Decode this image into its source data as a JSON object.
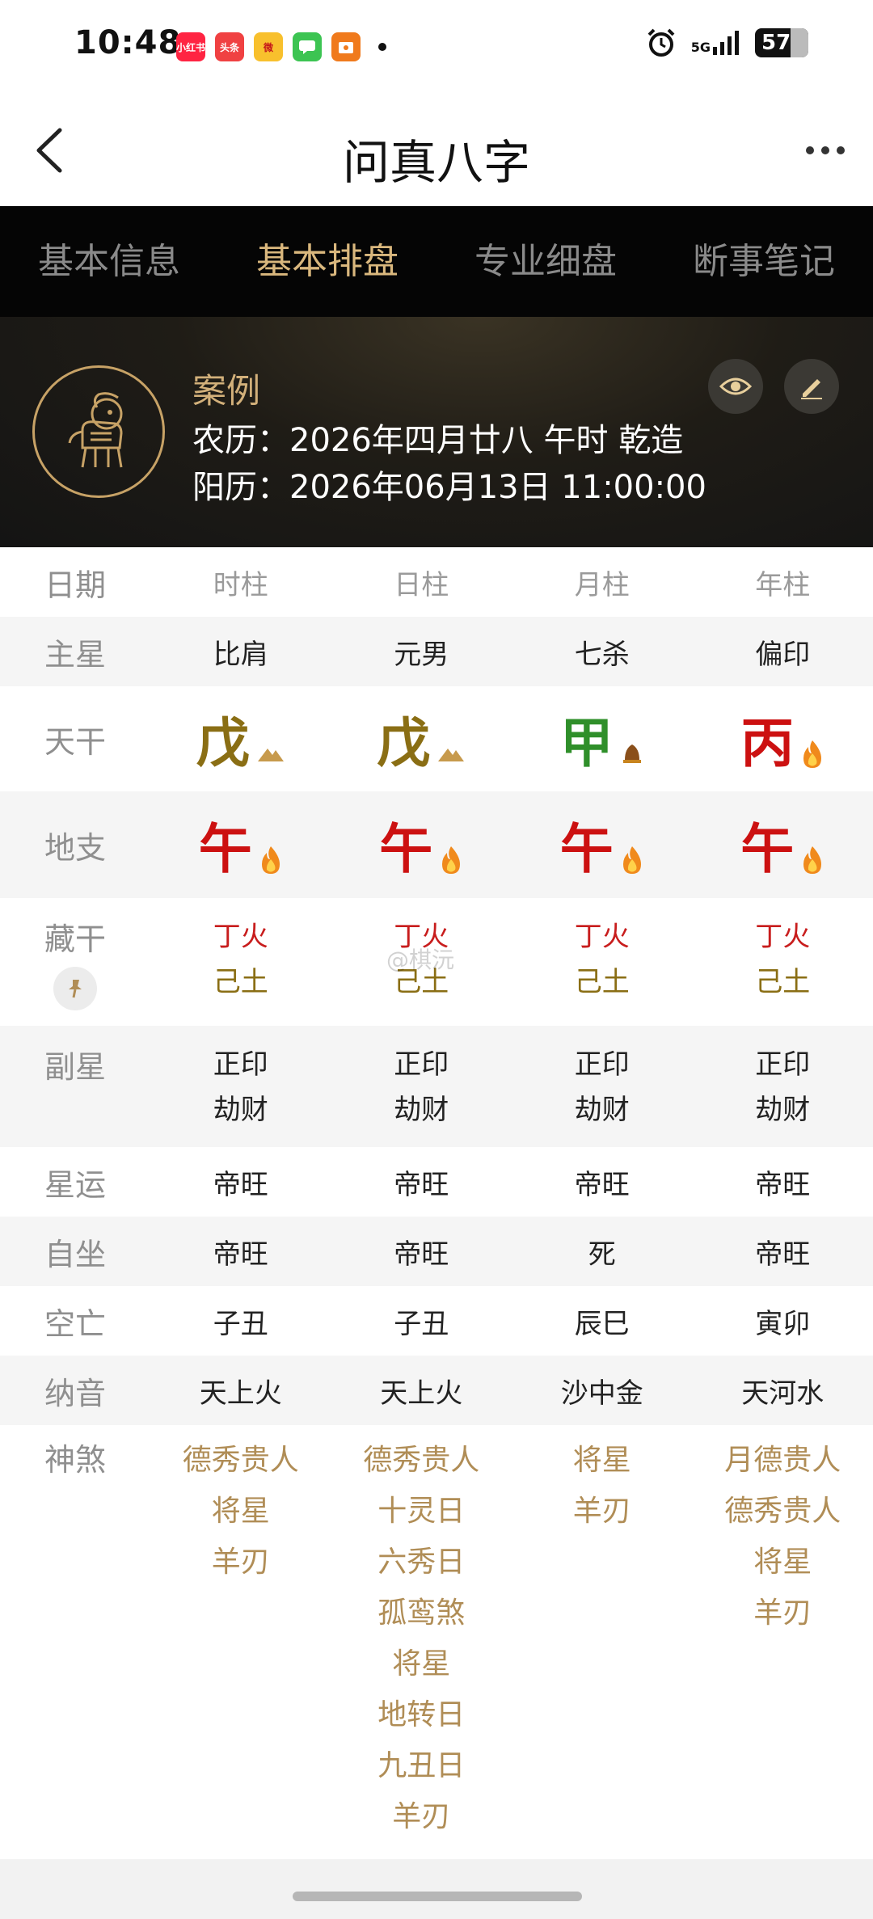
{
  "status_bar": {
    "time": "10:48",
    "apps": [
      {
        "name": "xiaohongshu",
        "label": "小红书",
        "color": "#ff2442"
      },
      {
        "name": "toutiao",
        "label": "头条",
        "color": "#f04142"
      },
      {
        "name": "weibo",
        "label": "微",
        "color": "#f8c02d"
      },
      {
        "name": "messages",
        "label": "",
        "color": "#3cc452"
      },
      {
        "name": "app-orange",
        "label": "",
        "color": "#f07a1c"
      }
    ],
    "network": "5G",
    "battery": "57"
  },
  "titlebar": {
    "title": "问真八字"
  },
  "tabs": [
    {
      "label": "基本信息",
      "active": false
    },
    {
      "label": "基本排盘",
      "active": true
    },
    {
      "label": "专业细盘",
      "active": false
    },
    {
      "label": "断事笔记",
      "active": false
    }
  ],
  "header": {
    "name": "案例",
    "lunar": "农历：2026年四月廿八 午时 乾造",
    "solar": "阳历：2026年06月13日 11:00:00"
  },
  "table": {
    "columns": {
      "label": "日期",
      "cols": [
        "时柱",
        "日柱",
        "月柱",
        "年柱"
      ]
    },
    "zhuxing": {
      "label": "主星",
      "cols": [
        "比肩",
        "元男",
        "七杀",
        "偏印"
      ]
    },
    "tiangan": {
      "label": "天干",
      "cols": [
        "戊",
        "戊",
        "甲",
        "丙"
      ]
    },
    "dizhi": {
      "label": "地支",
      "cols": [
        "午",
        "午",
        "午",
        "午"
      ]
    },
    "canggan": {
      "label": "藏干",
      "cols": [
        [
          "丁火",
          "己土"
        ],
        [
          "丁火",
          "己土"
        ],
        [
          "丁火",
          "己土"
        ],
        [
          "丁火",
          "己土"
        ]
      ]
    },
    "fuxing": {
      "label": "副星",
      "cols": [
        [
          "正印",
          "劫财"
        ],
        [
          "正印",
          "劫财"
        ],
        [
          "正印",
          "劫财"
        ],
        [
          "正印",
          "劫财"
        ]
      ]
    },
    "xingyun": {
      "label": "星运",
      "cols": [
        "帝旺",
        "帝旺",
        "帝旺",
        "帝旺"
      ]
    },
    "zizuo": {
      "label": "自坐",
      "cols": [
        "帝旺",
        "帝旺",
        "死",
        "帝旺"
      ]
    },
    "kongwang": {
      "label": "空亡",
      "cols": [
        "子丑",
        "子丑",
        "辰巳",
        "寅卯"
      ]
    },
    "nayin": {
      "label": "纳音",
      "cols": [
        "天上火",
        "天上火",
        "沙中金",
        "天河水"
      ]
    },
    "shensha": {
      "label": "神煞",
      "cols": [
        [
          "德秀贵人",
          "将星",
          "羊刃"
        ],
        [
          "德秀贵人",
          "十灵日",
          "六秀日",
          "孤鸾煞",
          "将星",
          "地转日",
          "九丑日",
          "羊刃"
        ],
        [
          "将星",
          "羊刃"
        ],
        [
          "月德贵人",
          "德秀贵人",
          "将星",
          "羊刃"
        ]
      ]
    }
  },
  "watermark": "@棋沅"
}
